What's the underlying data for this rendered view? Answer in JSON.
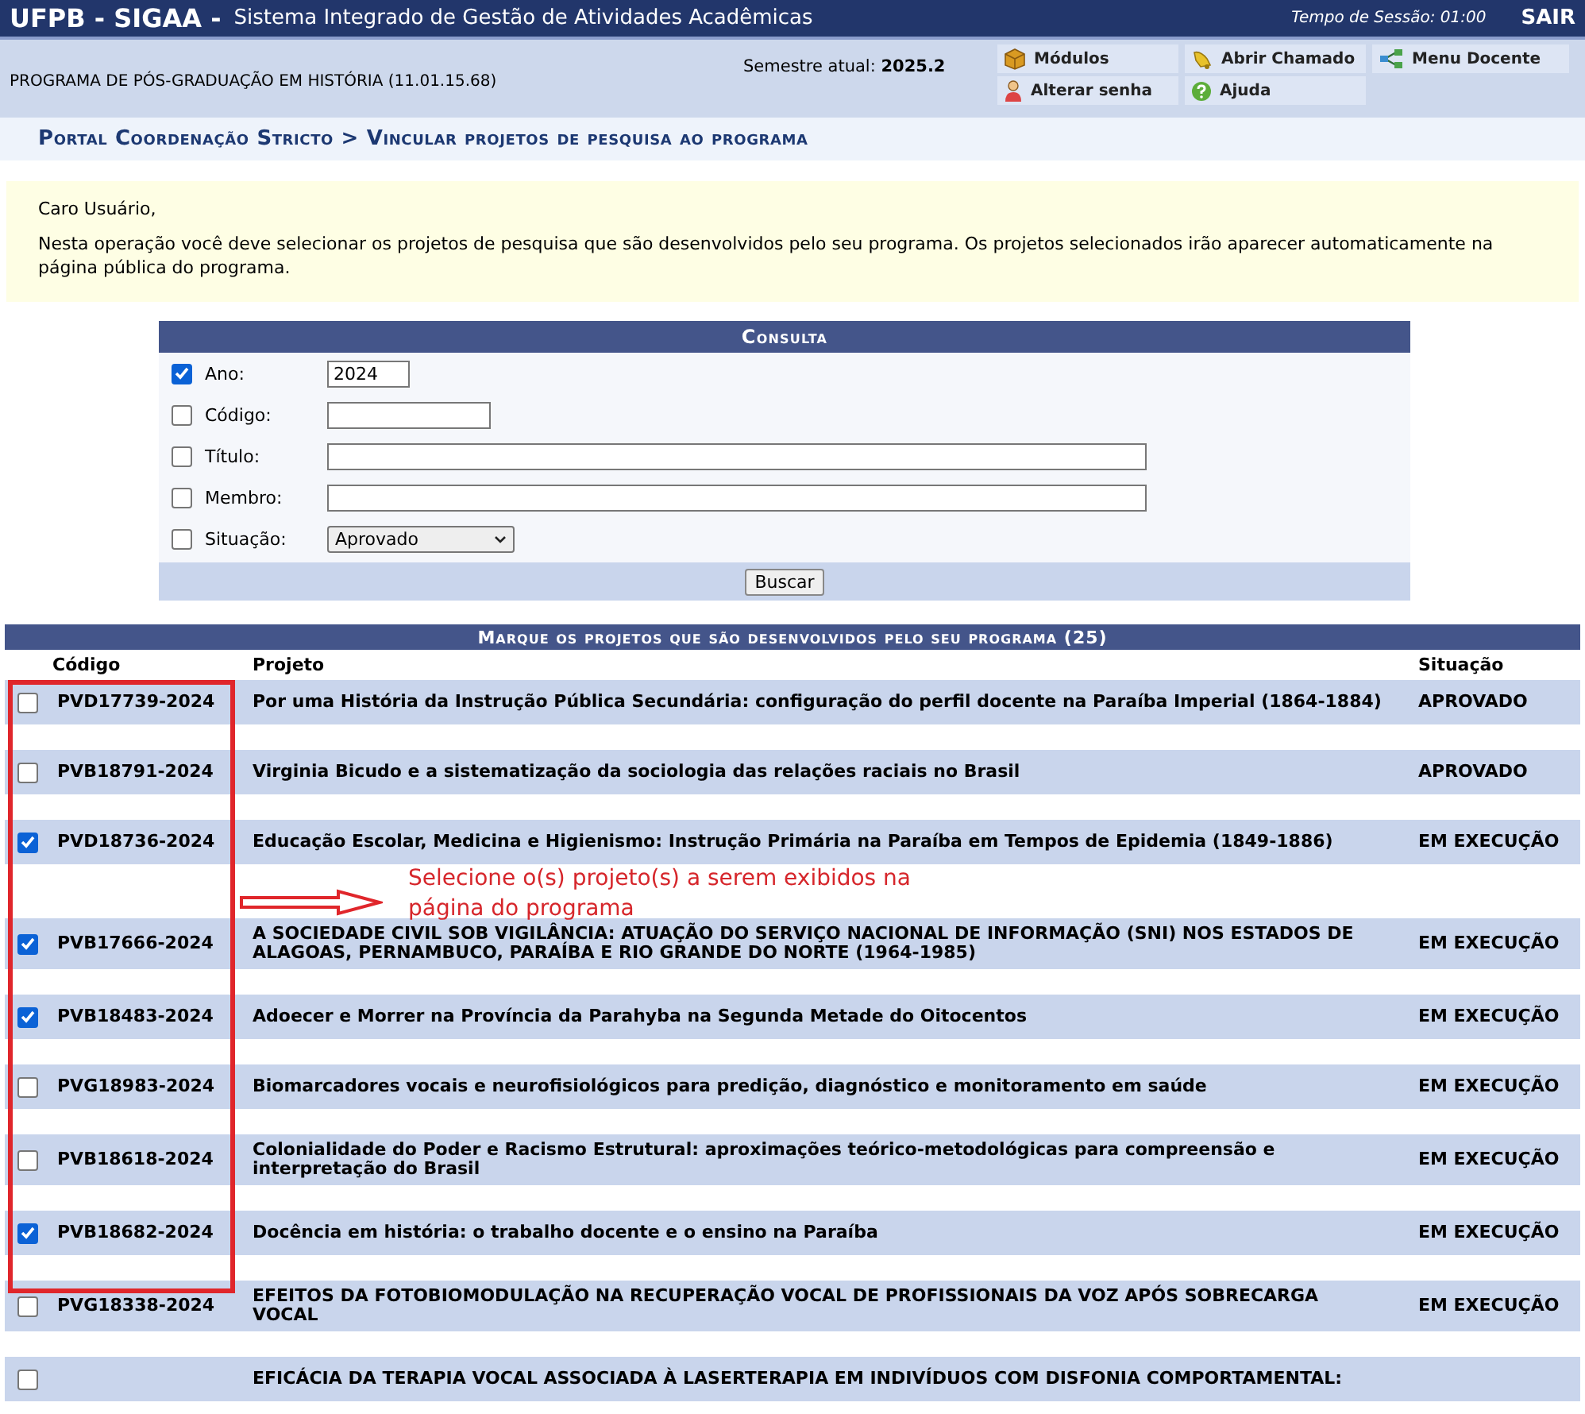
{
  "header": {
    "brand": "UFPB - SIGAA -",
    "system_name": "Sistema Integrado de Gestão de Atividades Acadêmicas",
    "session": "Tempo de Sessão: 01:00",
    "logout": "SAIR"
  },
  "info_bar": {
    "program": "PROGRAMA DE PÓS-GRADUAÇÃO EM HISTÓRIA (11.01.15.68)",
    "semester": "Semestre atual: **2025.2**",
    "menu": [
      {
        "label": "Módulos"
      },
      {
        "label": "Abrir Chamado"
      },
      {
        "label": "Menu Docente"
      },
      {
        "label": "Alterar senha"
      },
      {
        "label": "Ajuda"
      }
    ]
  },
  "breadcrumb": "Portal Coordenação Stricto > Vincular projetos de pesquisa ao programa",
  "notice": {
    "greeting": "Caro Usuário,",
    "text": "Nesta operação você deve selecionar os projetos de pesquisa que são desenvolvidos pelo seu programa. Os projetos selecionados irão aparecer automaticamente na página pública do programa."
  },
  "consulta": {
    "title": "Consulta",
    "filters": [
      {
        "label": "Ano:",
        "checked": true,
        "kind": "text",
        "value": "2024"
      },
      {
        "label": "Código:",
        "checked": false,
        "kind": "text"
      },
      {
        "label": "Título:",
        "checked": false,
        "kind": "text"
      },
      {
        "label": "Membro:",
        "checked": false,
        "kind": "text"
      },
      {
        "label": "Situação:",
        "checked": false,
        "kind": "select",
        "value": "Aprovado"
      }
    ],
    "button": "Buscar"
  },
  "projects": {
    "title": "Marque os projetos que são desenvolvidos pelo seu programa (25)",
    "columns": [
      "Código",
      "Projeto",
      "Situação"
    ],
    "rows": [
      {
        "code": "PVD17739-2024",
        "title": "Por uma História da Instrução Pública Secundária: configuração do perfil docente na Paraíba Imperial (1864-1884)",
        "status": "APROVADO",
        "checked": false
      },
      {
        "code": "PVB18791-2024",
        "title": "Virginia Bicudo e a sistematização da sociologia das relações raciais no Brasil",
        "status": "APROVADO",
        "checked": false
      },
      {
        "code": "PVD18736-2024",
        "title": "Educação Escolar, Medicina e Higienismo: Instrução Primária na Paraíba em Tempos de Epidemia (1849-1886)",
        "status": "EM EXECUÇÃO",
        "checked": true,
        "note": "Selecione o(s) projeto(s) a serem exibidos na página do programa"
      },
      {
        "code": "PVB17666-2024",
        "title": "A SOCIEDADE CIVIL SOB VIGILÂNCIA: ATUAÇÃO DO SERVIÇO NACIONAL DE INFORMAÇÃO (SNI) NOS ESTADOS DE ALAGOAS, PERNAMBUCO, PARAÍBA E RIO GRANDE DO NORTE (1964-1985)",
        "status": "EM EXECUÇÃO",
        "checked": true
      },
      {
        "code": "PVB18483-2024",
        "title": "Adoecer e Morrer na Província da Parahyba na Segunda Metade do Oitocentos",
        "status": "EM EXECUÇÃO",
        "checked": true
      },
      {
        "code": "PVG18983-2024",
        "title": "Biomarcadores vocais e neurofisiológicos para predição, diagnóstico e monitoramento em saúde",
        "status": "EM EXECUÇÃO",
        "checked": false
      },
      {
        "code": "PVB18618-2024",
        "title": "Colonialidade do Poder e Racismo Estrutural: aproximações teórico-metodológicas para compreensão e interpretação do Brasil",
        "status": "EM EXECUÇÃO",
        "checked": false
      },
      {
        "code": "PVB18682-2024",
        "title": "Docência em história: o trabalho docente e o ensino na Paraíba",
        "status": "EM EXECUÇÃO",
        "checked": true
      },
      {
        "code": "PVG18338-2024",
        "title": "EFEITOS DA FOTOBIOMODULAÇÃO NA RECUPERAÇÃO VOCAL DE PROFISSIONAIS DA VOZ APÓS SOBRECARGA VOCAL",
        "status": "EM EXECUÇÃO",
        "checked": false
      },
      {
        "title": "EFICÁCIA DA TERAPIA VOCAL ASSOCIADA À LASERTERAPIA EM INDIVÍDUOS COM DISFONIA COMPORTAMENTAL:",
        "checked": false
      }
    ]
  }
}
